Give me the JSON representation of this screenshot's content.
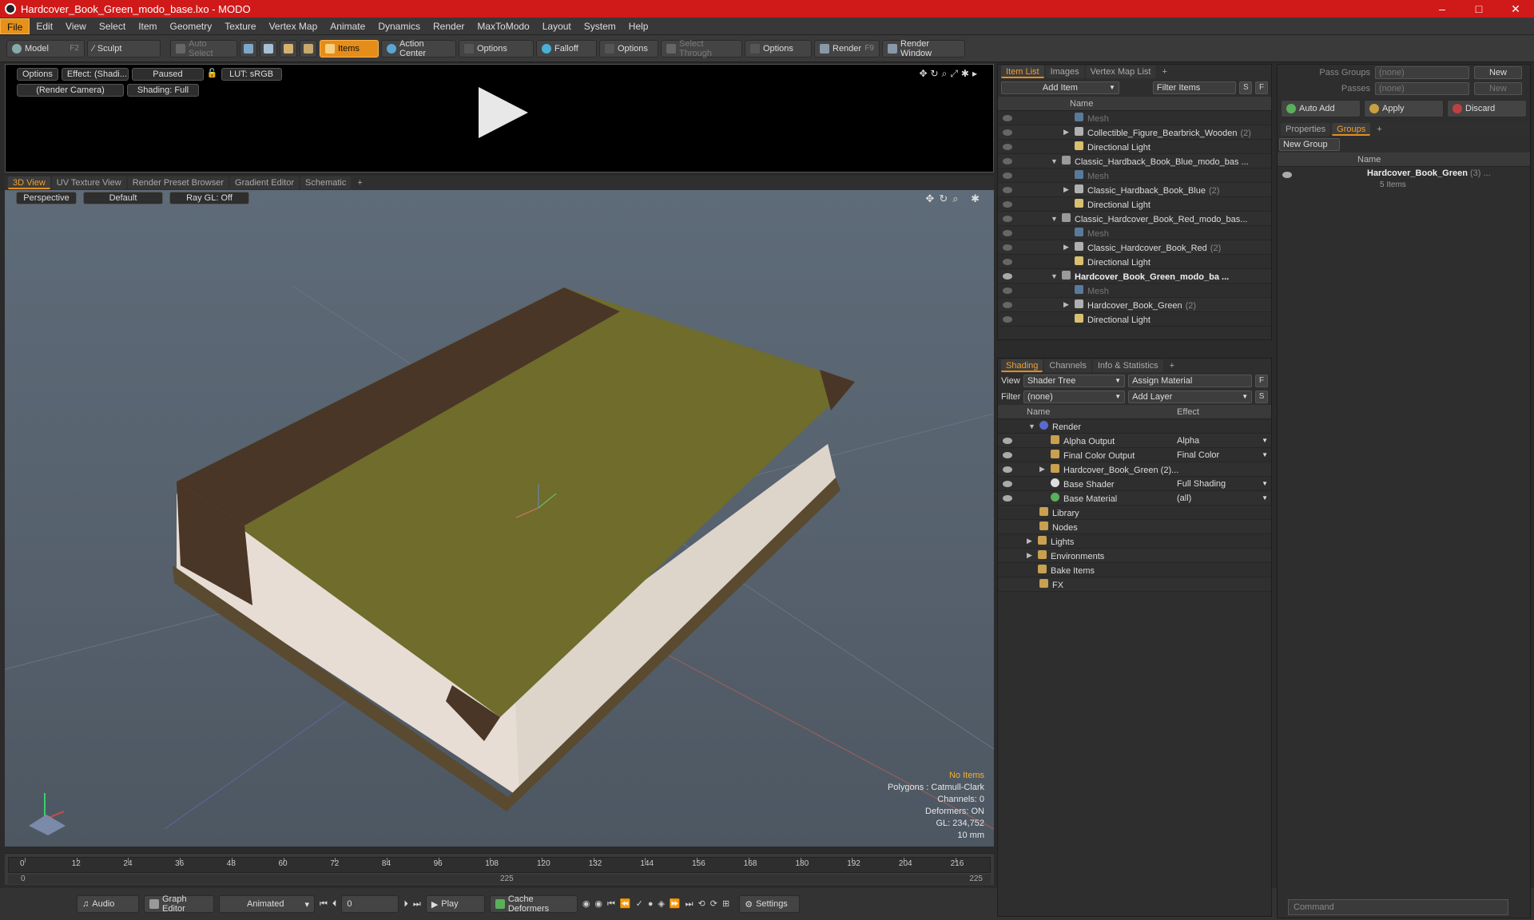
{
  "window": {
    "title": "Hardcover_Book_Green_modo_base.lxo - MODO",
    "min": "–",
    "max": "□",
    "close": "✕"
  },
  "menu": [
    "File",
    "Edit",
    "View",
    "Select",
    "Item",
    "Geometry",
    "Texture",
    "Vertex Map",
    "Animate",
    "Dynamics",
    "Render",
    "MaxToModo",
    "Layout",
    "System",
    "Help"
  ],
  "toolbar": {
    "model": "Model",
    "model_key": "F2",
    "sculpt": "Sculpt",
    "auto_select": "Auto Select",
    "items": "Items",
    "action_center": "Action Center",
    "options1": "Options",
    "falloff": "Falloff",
    "options2": "Options",
    "select_through": "Select Through",
    "options3": "Options",
    "render": "Render",
    "render_key": "F9",
    "render_window": "Render Window"
  },
  "render_panel": {
    "options": "Options",
    "effect": "Effect: (Shadi...",
    "paused": "Paused",
    "lut": "LUT: sRGB",
    "camera": "(Render Camera)",
    "shading": "Shading: Full"
  },
  "view_tabs": [
    "3D View",
    "UV Texture View",
    "Render Preset Browser",
    "Gradient Editor",
    "Schematic",
    "+"
  ],
  "viewport": {
    "perspective": "Perspective",
    "default": "Default",
    "raygl": "Ray GL: Off"
  },
  "hud": {
    "items": "No Items",
    "polygons": "Polygons : Catmull-Clark",
    "channels": "Channels: 0",
    "deformers": "Deformers: ON",
    "gl": "GL: 234,752",
    "scale": "10 mm"
  },
  "timeline": {
    "ticks": [
      "0",
      "12",
      "24",
      "36",
      "48",
      "60",
      "72",
      "84",
      "96",
      "108",
      "120",
      "132",
      "144",
      "156",
      "168",
      "180",
      "192",
      "204",
      "216"
    ],
    "start": "0",
    "mid": "225",
    "end": "225"
  },
  "transport": {
    "audio": "Audio",
    "graph_editor": "Graph Editor",
    "animated": "Animated",
    "frame": "0",
    "play": "Play",
    "cache": "Cache Deformers",
    "settings": "Settings"
  },
  "item_list": {
    "tabs": [
      "Item List",
      "Images",
      "Vertex Map List",
      "+"
    ],
    "add_item": "Add Item",
    "filter": "Filter Items",
    "s": "S",
    "f": "F",
    "col_name": "Name",
    "rows": [
      {
        "label": "Mesh",
        "indent": 2,
        "type": "mesh"
      },
      {
        "label": "Collectible_Figure_Bearbrick_Wooden",
        "count": "(2)",
        "indent": 2,
        "type": "group",
        "caret": "▶"
      },
      {
        "label": "Directional Light",
        "indent": 2,
        "type": "light"
      },
      {
        "label": "Classic_Hardback_Book_Blue_modo_bas ...",
        "indent": 1,
        "type": "scene",
        "caret": "▼"
      },
      {
        "label": "Mesh",
        "indent": 2,
        "type": "mesh"
      },
      {
        "label": "Classic_Hardback_Book_Blue",
        "count": "(2)",
        "indent": 2,
        "type": "group",
        "caret": "▶"
      },
      {
        "label": "Directional Light",
        "indent": 2,
        "type": "light"
      },
      {
        "label": "Classic_Hardcover_Book_Red_modo_bas...",
        "indent": 1,
        "type": "scene",
        "caret": "▼"
      },
      {
        "label": "Mesh",
        "indent": 2,
        "type": "mesh"
      },
      {
        "label": "Classic_Hardcover_Book_Red",
        "count": "(2)",
        "indent": 2,
        "type": "group",
        "caret": "▶"
      },
      {
        "label": "Directional Light",
        "indent": 2,
        "type": "light"
      },
      {
        "label": "Hardcover_Book_Green_modo_ba ...",
        "indent": 1,
        "type": "scene",
        "caret": "▼",
        "bold": true
      },
      {
        "label": "Mesh",
        "indent": 2,
        "type": "mesh"
      },
      {
        "label": "Hardcover_Book_Green",
        "count": "(2)",
        "indent": 2,
        "type": "group",
        "caret": "▶"
      },
      {
        "label": "Directional Light",
        "indent": 2,
        "type": "light"
      }
    ]
  },
  "shading": {
    "tabs": [
      "Shading",
      "Channels",
      "Info & Statistics",
      "+"
    ],
    "view_label": "View",
    "view_value": "Shader Tree",
    "assign": "Assign Material",
    "filter_label": "Filter",
    "filter_value": "(none)",
    "add_layer": "Add Layer",
    "col_name": "Name",
    "col_effect": "Effect",
    "rows": [
      {
        "label": "Render",
        "effect": "",
        "indent": 1,
        "caret": "▼",
        "eye": false
      },
      {
        "label": "Alpha Output",
        "effect": "Alpha",
        "indent": 2,
        "eye": true
      },
      {
        "label": "Final Color Output",
        "effect": "Final Color",
        "indent": 2,
        "eye": true
      },
      {
        "label": "Hardcover_Book_Green (2)...",
        "effect": "",
        "indent": 2,
        "caret": "▶",
        "eye": true
      },
      {
        "label": "Base Shader",
        "effect": "Full Shading",
        "indent": 2,
        "eye": true
      },
      {
        "label": "Base Material",
        "effect": "(all)",
        "indent": 2,
        "eye": true
      },
      {
        "label": "Library",
        "effect": "",
        "indent": 1,
        "eye": false
      },
      {
        "label": "Nodes",
        "effect": "",
        "indent": 1,
        "eye": false
      },
      {
        "label": "Lights",
        "effect": "",
        "indent": 0,
        "caret": "▶",
        "eye": false
      },
      {
        "label": "Environments",
        "effect": "",
        "indent": 0,
        "caret": "▶",
        "eye": false
      },
      {
        "label": "Bake Items",
        "effect": "",
        "indent": 0,
        "eye": false
      },
      {
        "label": "FX",
        "effect": "",
        "indent": 1,
        "eye": false
      }
    ]
  },
  "groups_panel": {
    "pass_groups": "Pass Groups",
    "pass_groups_value": "(none)",
    "new": "New",
    "passes": "Passes",
    "passes_value": "(none)",
    "new2": "New",
    "auto_add": "Auto Add",
    "apply": "Apply",
    "discard": "Discard",
    "tabs": [
      "Properties",
      "Groups",
      "+"
    ],
    "new_group": "New Group",
    "col_name": "Name",
    "group_name": "Hardcover_Book_Green",
    "group_count": "(3) ...",
    "group_items": "5 Items"
  },
  "command": "Command"
}
